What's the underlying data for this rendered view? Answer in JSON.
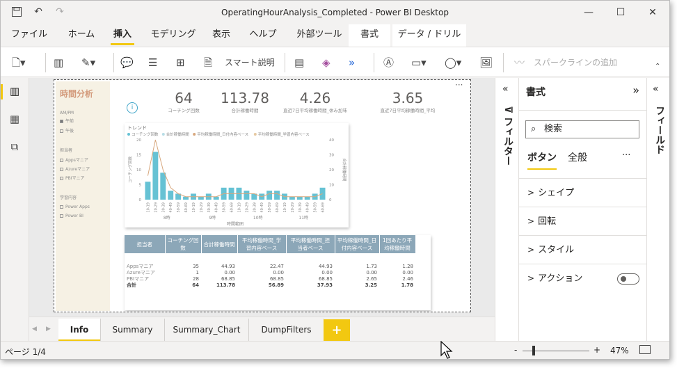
{
  "window": {
    "title": "OperatingHourAnalysis_Completed - Power BI Desktop",
    "minimize": "—",
    "maximize": "☐",
    "close": "✕"
  },
  "menu_tabs": [
    "ファイル",
    "ホーム",
    "挿入",
    "モデリング",
    "表示",
    "ヘルプ",
    "外部ツール",
    "書式",
    "データ / ドリル"
  ],
  "active_tab": "挿入",
  "ribbon": {
    "smart_narrative": "スマート説明",
    "sparkline": "スパークラインの追加"
  },
  "report": {
    "slicer_title": "時間分析",
    "slicer_ampm_label": "AM/PM",
    "slicer_ampm": [
      "午前",
      "午後"
    ],
    "slicer_owner_label": "担当者",
    "slicer_owner": [
      "Appsマニア",
      "Azureマニア",
      "PBIマニア"
    ],
    "slicer_topic_label": "学習内容",
    "slicer_topic": [
      "Power Apps",
      "Power BI"
    ],
    "kpis": [
      {
        "value": "64",
        "label": "コーチング回数"
      },
      {
        "value": "113.78",
        "label": "合計稼働時間"
      },
      {
        "value": "4.26",
        "label": "直近7日平均稼働時間_休み加味"
      },
      {
        "value": "3.65",
        "label": "直近7日平均稼働時間_平均"
      }
    ],
    "more": "···"
  },
  "chart_data": {
    "type": "bar",
    "title": "トレンド",
    "legend": [
      "コーチング回数",
      "合計稼働時間",
      "平均稼働時間_日付内容ベース",
      "平均稼働時間_学習内容ベース"
    ],
    "categories": [
      "10-19",
      "20-29",
      "30-39",
      "40-49",
      "50-59",
      "60-69",
      "10-19",
      "20-29",
      "30-39",
      "40-49",
      "50-59",
      "60-69",
      "10-19",
      "20-29",
      "30-39",
      "40-49",
      "50-59",
      "60-69",
      "10-19",
      "20-29",
      "30-39",
      "40-49",
      "50-59",
      "60-69"
    ],
    "group_labels": [
      "8時",
      "9時",
      "10時",
      "11時"
    ],
    "values": [
      6,
      16,
      9,
      3,
      2,
      1,
      2,
      1,
      2,
      1,
      4,
      4,
      4,
      3,
      2,
      2,
      3,
      3,
      2,
      1,
      1,
      1,
      2,
      4
    ],
    "line_values": [
      8,
      20,
      10,
      4,
      2,
      1,
      1,
      1,
      1,
      1,
      2,
      2,
      2,
      2,
      2,
      1,
      2,
      2,
      1,
      1,
      1,
      1,
      1,
      2
    ],
    "ylim": [
      0,
      20
    ],
    "y_ticks": [
      "20",
      "15",
      "10",
      "5",
      "0"
    ],
    "y2_ticks": [
      "40",
      "30",
      "20",
      "10",
      "0"
    ],
    "xlabel": "時間範囲",
    "ylabel": "コーチング回数",
    "y2label": "合計稼働時間"
  },
  "table": {
    "headers": [
      "担当者",
      "コーチング回数",
      "合計稼働時間",
      "平均稼働時間_学習内容ベース",
      "平均稼働時間_担当者ベース",
      "平均稼働時間_日付内容ベース",
      "1回あたり平均稼働時間"
    ],
    "rows": [
      [
        "Appsマニア",
        "35",
        "44.93",
        "22.47",
        "44.93",
        "1.73",
        "1.28"
      ],
      [
        "Azureマニア",
        "1",
        "0.00",
        "0.00",
        "0.00",
        "0.00",
        "0.00"
      ],
      [
        "PBIマニア",
        "28",
        "68.85",
        "68.85",
        "68.85",
        "2.65",
        "2.46"
      ]
    ],
    "total": [
      "合計",
      "64",
      "113.78",
      "56.89",
      "37.93",
      "3.25",
      "1.78"
    ]
  },
  "panes": {
    "filters": "フィルター",
    "format": "書式",
    "fields": "フィールド",
    "search_placeholder": "検索",
    "format_tabs": [
      "ボタン",
      "全般"
    ],
    "more": "···",
    "sections": [
      "シェイプ",
      "回転",
      "スタイル",
      "アクション"
    ]
  },
  "page_tabs": [
    "Info",
    "Summary",
    "Summary_Chart",
    "DumpFilters"
  ],
  "add_page": "+",
  "status": {
    "page": "ページ 1/4",
    "zoom": "47%",
    "minus": "-",
    "plus": "+"
  }
}
